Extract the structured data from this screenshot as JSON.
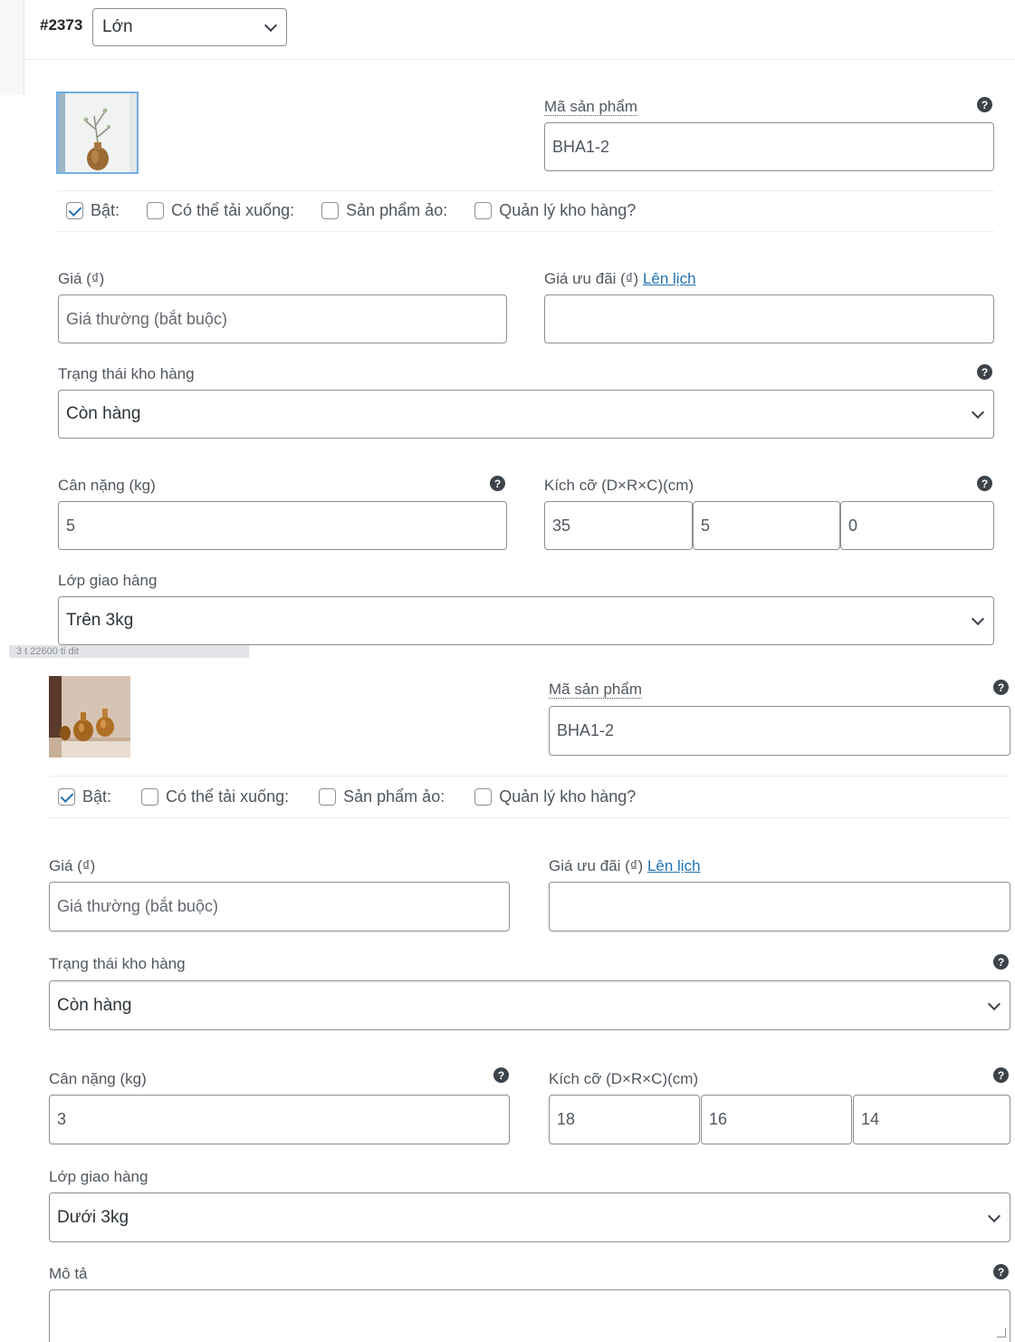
{
  "header": {
    "variation_id": "#2373",
    "variation_value": "Lớn"
  },
  "tooltip_fragment": "  3  t 22600  ti   dit",
  "labels": {
    "sku": "Mã sản phẩm",
    "enabled": "Bật:",
    "downloadable": "Có thể tải xuống:",
    "virtual": "Sản phẩm ảo:",
    "manage_stock": "Quản lý kho hàng?",
    "regular_price": "Giá (₫)",
    "sale_price": "Giá ưu đãi (₫)",
    "schedule": "Lên lịch",
    "stock_status": "Trạng thái kho hàng",
    "weight": "Cân nặng (kg)",
    "dimensions": "Kích cỡ (D×R×C)(cm)",
    "shipping_class": "Lớp giao hàng",
    "description": "Mô tả",
    "help": "?"
  },
  "variations": [
    {
      "thumb_icon": "vase-with-branch-image",
      "sku": "BHA1-2",
      "enabled": true,
      "downloadable": false,
      "virtual": false,
      "manage_stock": false,
      "regular_price_placeholder": "Giá thường (bắt buộc)",
      "sale_price": "",
      "stock_status": "Còn hàng",
      "weight": "5",
      "length": "35",
      "width": "5",
      "height": "0",
      "shipping_class": "Trên 3kg"
    },
    {
      "thumb_icon": "amber-vases-image",
      "sku": "BHA1-2",
      "enabled": true,
      "downloadable": false,
      "virtual": false,
      "manage_stock": false,
      "regular_price_placeholder": "Giá thường (bắt buộc)",
      "sale_price": "",
      "stock_status": "Còn hàng",
      "weight": "3",
      "length": "18",
      "width": "16",
      "height": "14",
      "shipping_class": "Dưới 3kg",
      "description": ""
    }
  ]
}
